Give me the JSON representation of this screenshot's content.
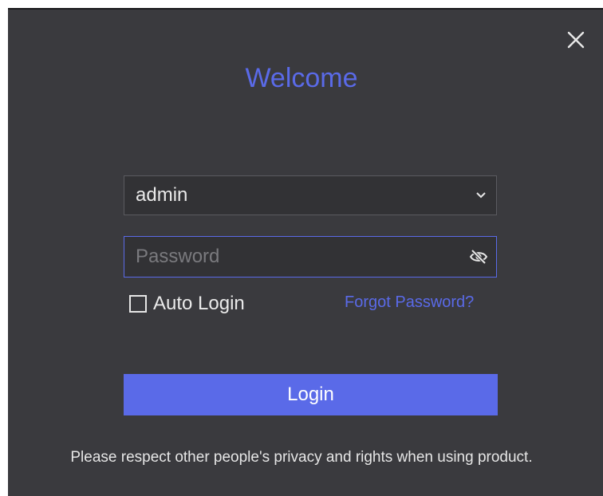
{
  "dialog": {
    "title": "Welcome",
    "close_icon": "close-icon",
    "username": {
      "value": "admin",
      "icon": "chevron-down-icon"
    },
    "password": {
      "value": "",
      "placeholder": "Password",
      "icon": "eye-slash-icon"
    },
    "auto_login": {
      "label": "Auto Login",
      "checked": false
    },
    "forgot_password": "Forgot Password?",
    "login_label": "Login",
    "notice": "Please respect other people's privacy and rights when using product."
  },
  "colors": {
    "background": "#3a3a3e",
    "accent": "#5a6ae8",
    "field_background": "#323235",
    "text": "#eaeaea"
  }
}
